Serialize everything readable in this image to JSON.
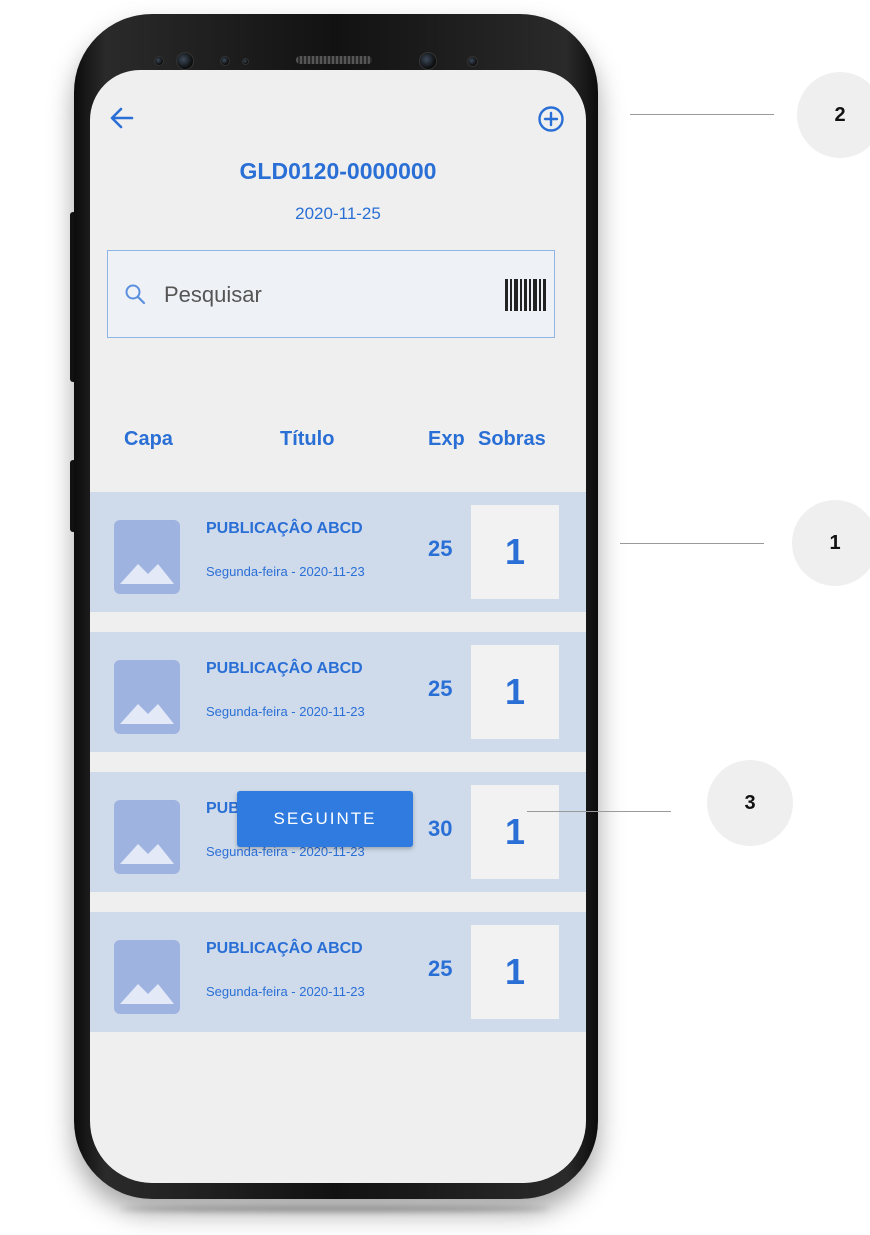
{
  "header": {
    "doc_code": "GLD0120-0000000",
    "doc_date": "2020-11-25",
    "back_icon": "arrow-left-icon",
    "add_icon": "plus-circle-icon"
  },
  "search": {
    "placeholder": "Pesquisar",
    "value": "",
    "search_icon": "magnifier-icon",
    "barcode_icon": "barcode-icon"
  },
  "columns": {
    "capa": "Capa",
    "titulo": "Título",
    "exp": "Exp",
    "sobras": "Sobras"
  },
  "items": [
    {
      "title": "PUBLICAÇÂO ABCD",
      "subtitle": "Segunda-feira - 2020-11-23",
      "exp": "25",
      "sobras": "1"
    },
    {
      "title": "PUBLICAÇÂO ABCD",
      "subtitle": "Segunda-feira - 2020-11-23",
      "exp": "25",
      "sobras": "1"
    },
    {
      "title": "PUBLICAÇÂO ABCD",
      "subtitle": "Segunda-feira - 2020-11-23",
      "exp": "30",
      "sobras": "1"
    },
    {
      "title": "PUBLICAÇÂO ABCD",
      "subtitle": "Segunda-feira - 2020-11-23",
      "exp": "25",
      "sobras": "1"
    }
  ],
  "actions": {
    "next_label": "SEGUINTE"
  },
  "callouts": {
    "one": "1",
    "two": "2",
    "three": "3"
  },
  "colors": {
    "accent": "#2a6fd6",
    "button": "#2f7be0",
    "row_background": "#cfdbea",
    "screen_background": "#efefef"
  }
}
